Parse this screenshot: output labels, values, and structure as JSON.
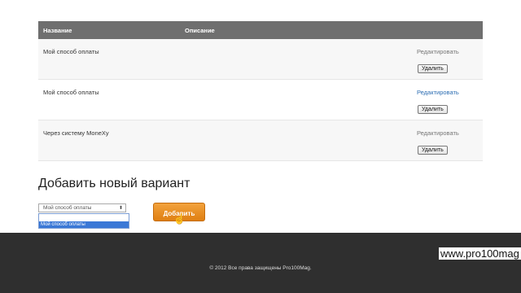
{
  "table": {
    "headers": {
      "name": "Название",
      "description": "Описание"
    },
    "rows": [
      {
        "name": "Мой способ оплаты",
        "edit": "Редактировать",
        "delete": "Удалить"
      },
      {
        "name": "Мой способ оплаты",
        "edit": "Редактировать",
        "delete": "Удалить"
      },
      {
        "name": "Через систему MoneXy",
        "edit": "Редактировать",
        "delete": "Удалить"
      }
    ]
  },
  "add_section": {
    "title": "Добавить новый вариант",
    "select_value": "Мой способ оплаты",
    "dropdown_option": "Мой способ оплаты",
    "add_button": "Добавить"
  },
  "footer": {
    "copyright": "© 2012 Все права защищены Pro100Mag."
  },
  "watermark": "www.pro100mag",
  "colors": {
    "header_bg": "#6f6f6f",
    "accent": "#e58a1d",
    "footer_bg": "#2f2f2f"
  },
  "icons": {
    "cursor": "hand-cursor-icon",
    "select_arrow": "chevron-updown-icon"
  }
}
